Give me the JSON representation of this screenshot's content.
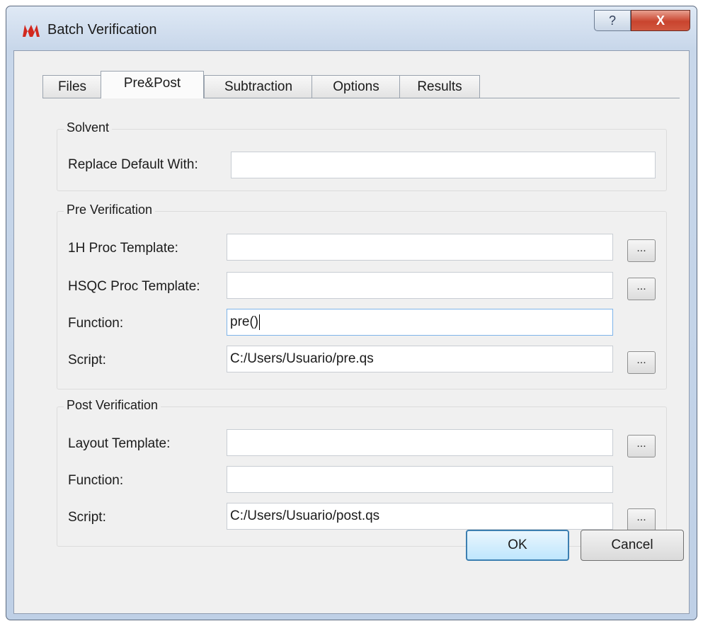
{
  "window": {
    "title": "Batch Verification",
    "help_label": "?",
    "close_label": "X"
  },
  "tabs": [
    {
      "label": "Files"
    },
    {
      "label": "Pre&Post",
      "active": true
    },
    {
      "label": "Subtraction"
    },
    {
      "label": "Options"
    },
    {
      "label": "Results"
    }
  ],
  "solvent": {
    "title": "Solvent",
    "replace_label": "Replace Default With:",
    "replace_value": ""
  },
  "pre": {
    "title": "Pre Verification",
    "h1_label": "1H Proc Template:",
    "h1_value": "",
    "hsqc_label": "HSQC Proc Template:",
    "hsqc_value": "",
    "function_label": "Function:",
    "function_value": "pre()",
    "script_label": "Script:",
    "script_value": "C:/Users/Usuario/pre.qs"
  },
  "post": {
    "title": "Post Verification",
    "layout_label": "Layout Template:",
    "layout_value": "",
    "function_label": "Function:",
    "function_value": "",
    "script_label": "Script:",
    "script_value": "C:/Users/Usuario/post.qs"
  },
  "browse_label": "...",
  "buttons": {
    "ok": "OK",
    "cancel": "Cancel"
  },
  "colors": {
    "focus_border": "#7eb4ea",
    "close_red": "#c9442e",
    "ok_border": "#3c7fb1"
  },
  "icons": {
    "app": "mestrenova-logo-icon"
  }
}
